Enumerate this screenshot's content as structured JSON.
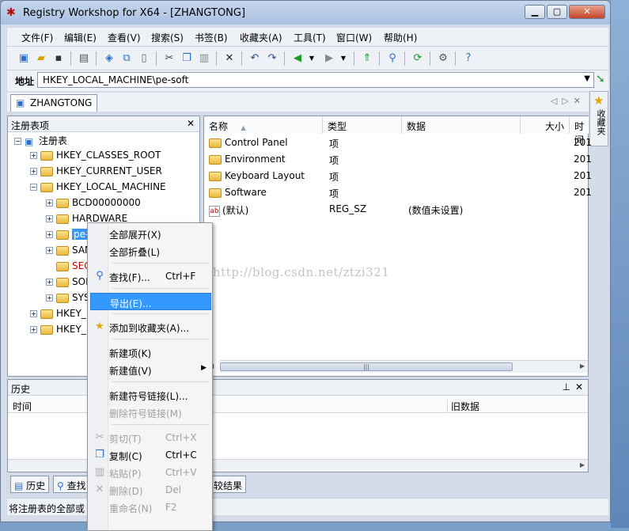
{
  "window": {
    "title": "Registry Workshop for X64 - [ZHANGTONG]",
    "controls": [
      "0",
      "1",
      "r"
    ]
  },
  "menubar": [
    "文件(F)",
    "编辑(E)",
    "查看(V)",
    "搜索(S)",
    "书签(B)",
    "收藏夹(A)",
    "工具(T)",
    "窗口(W)",
    "帮助(H)"
  ],
  "address": {
    "label": "地址",
    "value": "HKEY_LOCAL_MACHINE\\pe-soft"
  },
  "tab": {
    "label": "ZHANGTONG"
  },
  "favorites_side": "收藏夹",
  "tree_panel": {
    "title": "注册表项",
    "root": "注册表",
    "items": [
      {
        "label": "HKEY_CLASSES_ROOT",
        "level": 1,
        "exp": "+"
      },
      {
        "label": "HKEY_CURRENT_USER",
        "level": 1,
        "exp": "+"
      },
      {
        "label": "HKEY_LOCAL_MACHINE",
        "level": 1,
        "exp": "−"
      },
      {
        "label": "BCD00000000",
        "level": 2,
        "exp": "+"
      },
      {
        "label": "HARDWARE",
        "level": 2,
        "exp": "+"
      },
      {
        "label": "pe-",
        "level": 2,
        "exp": "+",
        "selected": true
      },
      {
        "label": "SAM",
        "level": 2,
        "exp": "+"
      },
      {
        "label": "SEC",
        "level": 2,
        "exp": "",
        "red": true
      },
      {
        "label": "SOF",
        "level": 2,
        "exp": "+"
      },
      {
        "label": "SYS",
        "level": 2,
        "exp": "+"
      },
      {
        "label": "HKEY_",
        "level": 1,
        "exp": "+"
      },
      {
        "label": "HKEY_",
        "level": 1,
        "exp": "+"
      }
    ]
  },
  "list_panel": {
    "columns": [
      "名称",
      "类型",
      "数据",
      "大小",
      "时间"
    ],
    "rows": [
      {
        "name": "Control Panel",
        "type": "项",
        "data": "",
        "time": "201",
        "icon": "folder"
      },
      {
        "name": "Environment",
        "type": "项",
        "data": "",
        "time": "201",
        "icon": "folder"
      },
      {
        "name": "Keyboard Layout",
        "type": "项",
        "data": "",
        "time": "201",
        "icon": "folder"
      },
      {
        "name": "Software",
        "type": "项",
        "data": "",
        "time": "201",
        "icon": "folder"
      },
      {
        "name": "(默认)",
        "type": "REG_SZ",
        "data": "(数值未设置)",
        "time": "",
        "icon": "ab"
      }
    ]
  },
  "history_panel": {
    "title": "历史",
    "columns": [
      "时间",
      "旧数据"
    ]
  },
  "bottom_tabs": [
    "历史",
    "查找",
    "比较结果"
  ],
  "status": "将注册表的全部或",
  "watermark": "http://blog.csdn.net/ztzi321",
  "context_menu": {
    "items": [
      {
        "label": "全部展开(X)",
        "shortcut": "",
        "icon": "",
        "state": "normal"
      },
      {
        "label": "全部折叠(L)",
        "shortcut": "",
        "icon": "",
        "state": "normal"
      },
      {
        "sep": true
      },
      {
        "label": "查找(F)...",
        "shortcut": "Ctrl+F",
        "icon": "search",
        "state": "normal"
      },
      {
        "sep": true
      },
      {
        "label": "导出(E)...",
        "shortcut": "",
        "icon": "",
        "state": "highlight"
      },
      {
        "sep": true
      },
      {
        "label": "添加到收藏夹(A)...",
        "shortcut": "",
        "icon": "star",
        "state": "normal"
      },
      {
        "sep": true
      },
      {
        "label": "新建项(K)",
        "shortcut": "",
        "icon": "",
        "state": "normal"
      },
      {
        "label": "新建值(V)",
        "shortcut": "",
        "icon": "",
        "state": "normal",
        "submenu": true
      },
      {
        "sep": true
      },
      {
        "label": "新建符号链接(L)...",
        "shortcut": "",
        "icon": "",
        "state": "normal"
      },
      {
        "label": "删除符号链接(M)",
        "shortcut": "",
        "icon": "",
        "state": "disabled"
      },
      {
        "sep": true
      },
      {
        "label": "剪切(T)",
        "shortcut": "Ctrl+X",
        "icon": "cut",
        "state": "disabled"
      },
      {
        "label": "复制(C)",
        "shortcut": "Ctrl+C",
        "icon": "copy",
        "state": "normal"
      },
      {
        "label": "粘贴(P)",
        "shortcut": "Ctrl+V",
        "icon": "paste",
        "state": "disabled"
      },
      {
        "label": "删除(D)",
        "shortcut": "Del",
        "icon": "delete",
        "state": "disabled"
      },
      {
        "label": "重命名(N)",
        "shortcut": "F2",
        "icon": "",
        "state": "disabled"
      }
    ]
  }
}
